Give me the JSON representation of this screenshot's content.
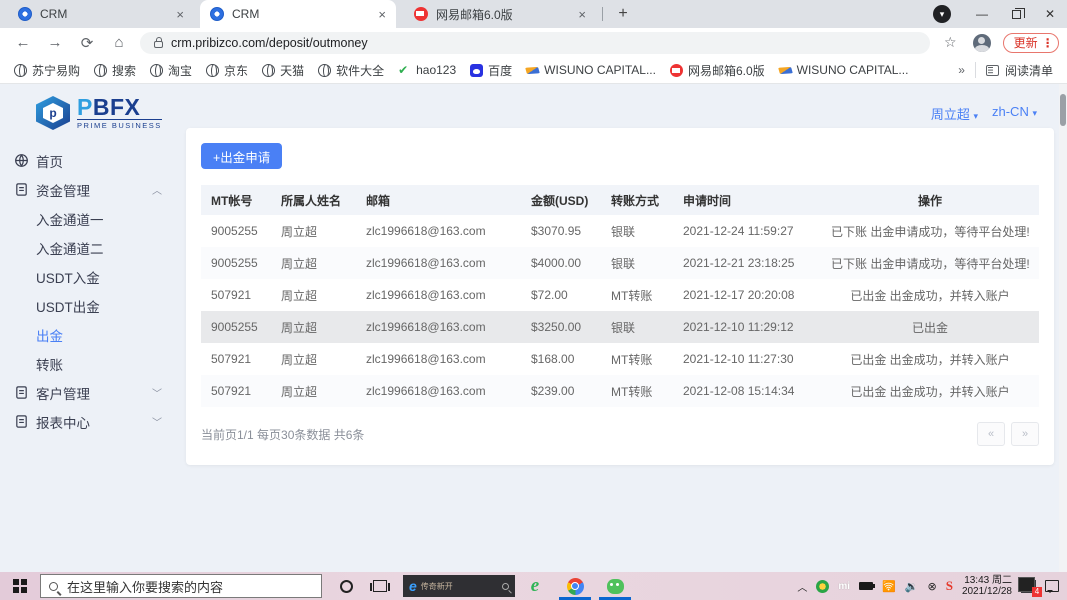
{
  "browser": {
    "tabs": [
      {
        "title": "CRM"
      },
      {
        "title": "CRM"
      },
      {
        "title": "网易邮箱6.0版"
      }
    ],
    "new_tab_label": "+",
    "close_label": "×",
    "media_button_glyph": "▾",
    "minimize_glyph": "—",
    "close_window_glyph": "✕",
    "back_glyph": "←",
    "forward_glyph": "→",
    "reload_glyph": "⟳",
    "home_glyph": "⌂",
    "url": "crm.pribizco.com/deposit/outmoney",
    "star_glyph": "☆",
    "update_label": "更新",
    "update_dots": "⋮",
    "bookmarks": [
      {
        "label": "苏宁易购",
        "icon": "globe"
      },
      {
        "label": "搜索",
        "icon": "globe"
      },
      {
        "label": "淘宝",
        "icon": "globe"
      },
      {
        "label": "京东",
        "icon": "globe"
      },
      {
        "label": "天猫",
        "icon": "globe"
      },
      {
        "label": "软件大全",
        "icon": "globe"
      },
      {
        "label": "hao123",
        "icon": "hao"
      },
      {
        "label": "百度",
        "icon": "baidu"
      },
      {
        "label": "WISUNO CAPITAL...",
        "icon": "wisuno"
      },
      {
        "label": "网易邮箱6.0版",
        "icon": "mail"
      },
      {
        "label": "WISUNO CAPITAL...",
        "icon": "wisuno"
      }
    ],
    "bookmarks_overflow": "»",
    "reading_list_label": "阅读清单"
  },
  "site": {
    "logo": {
      "icon_letter": "p",
      "text": "PBFX",
      "subtext": "PRIME BUSINESS"
    },
    "user_name": "周立超",
    "language": "zh-CN",
    "caret": "▾",
    "sidebar": [
      {
        "label": "首页",
        "icon": "home",
        "level": 0,
        "chevron": ""
      },
      {
        "label": "资金管理",
        "icon": "doc",
        "level": 0,
        "chevron": "︿"
      },
      {
        "label": "入金通道一",
        "icon": "",
        "level": 1,
        "chevron": ""
      },
      {
        "label": "入金通道二",
        "icon": "",
        "level": 1,
        "chevron": ""
      },
      {
        "label": "USDT入金",
        "icon": "",
        "level": 1,
        "chevron": ""
      },
      {
        "label": "USDT出金",
        "icon": "",
        "level": 1,
        "chevron": ""
      },
      {
        "label": "出金",
        "icon": "",
        "level": 1,
        "chevron": "",
        "active": true
      },
      {
        "label": "转账",
        "icon": "",
        "level": 1,
        "chevron": ""
      },
      {
        "label": "客户管理",
        "icon": "doc",
        "level": 0,
        "chevron": "﹀"
      },
      {
        "label": "报表中心",
        "icon": "doc",
        "level": 0,
        "chevron": "﹀"
      }
    ],
    "apply_button": "+出金申请",
    "table": {
      "headers": [
        "MT帐号",
        "所属人姓名",
        "邮箱",
        "金额(USD)",
        "转账方式",
        "申请时间",
        "操作"
      ],
      "rows": [
        {
          "cells": [
            "9005255",
            "周立超",
            "zlc1996618@163.com",
            "$3070.95",
            "银联",
            "2021-12-24 11:59:27",
            "已下账 出金申请成功，等待平台处理!"
          ],
          "highlight": false
        },
        {
          "cells": [
            "9005255",
            "周立超",
            "zlc1996618@163.com",
            "$4000.00",
            "银联",
            "2021-12-21 23:18:25",
            "已下账 出金申请成功，等待平台处理!"
          ],
          "highlight": false
        },
        {
          "cells": [
            "507921",
            "周立超",
            "zlc1996618@163.com",
            "$72.00",
            "MT转账",
            "2021-12-17 20:20:08",
            "已出金 出金成功，并转入账户"
          ],
          "highlight": false
        },
        {
          "cells": [
            "9005255",
            "周立超",
            "zlc1996618@163.com",
            "$3250.00",
            "银联",
            "2021-12-10 11:29:12",
            "已出金"
          ],
          "highlight": true
        },
        {
          "cells": [
            "507921",
            "周立超",
            "zlc1996618@163.com",
            "$168.00",
            "MT转账",
            "2021-12-10 11:27:30",
            "已出金 出金成功，并转入账户"
          ],
          "highlight": false
        },
        {
          "cells": [
            "507921",
            "周立超",
            "zlc1996618@163.com",
            "$239.00",
            "MT转账",
            "2021-12-08 15:14:34",
            "已出金 出金成功，并转入账户"
          ],
          "highlight": false
        }
      ]
    },
    "pagination": {
      "info": "当前页1/1 每页30条数据 共6条",
      "prev": "«",
      "next": "»"
    }
  },
  "taskbar": {
    "search_placeholder": "在这里输入你要搜索的内容",
    "ie_widget_text": "传奇新开",
    "ie_widget_e": "e",
    "tray_mi": "mi",
    "tray_wifi": "🛜",
    "tray_volume": "🔉",
    "tray_x": "⊗",
    "tray_sogou": "S",
    "clock_time": "13:43 周二",
    "clock_date": "2021/12/28",
    "ime_badge": "4",
    "chevron_up": "︿"
  }
}
